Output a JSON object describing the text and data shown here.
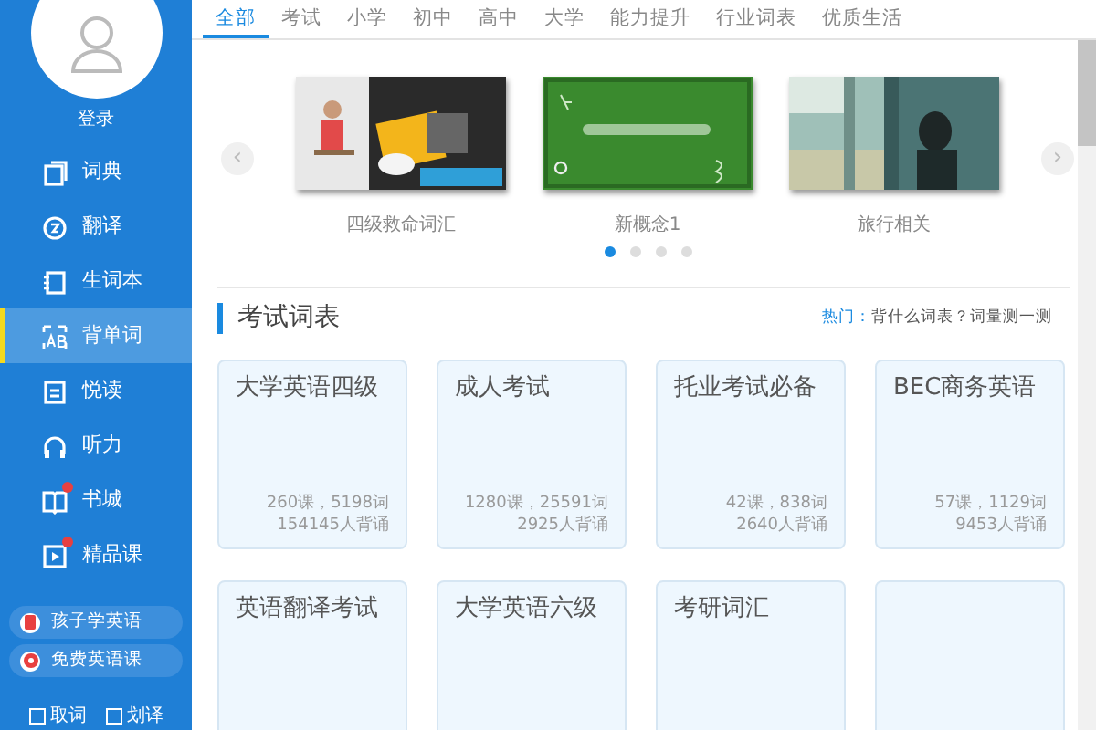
{
  "sidebar": {
    "login": "登录",
    "items": [
      {
        "label": "词典",
        "selected": false,
        "dot": false
      },
      {
        "label": "翻译",
        "selected": false,
        "dot": false
      },
      {
        "label": "生词本",
        "selected": false,
        "dot": false
      },
      {
        "label": "背单词",
        "selected": true,
        "dot": false
      },
      {
        "label": "悦读",
        "selected": false,
        "dot": false
      },
      {
        "label": "听力",
        "selected": false,
        "dot": false
      },
      {
        "label": "书城",
        "selected": false,
        "dot": true
      },
      {
        "label": "精品课",
        "selected": false,
        "dot": true
      }
    ],
    "promos": [
      {
        "label": "孩子学英语"
      },
      {
        "label": "免费英语课"
      }
    ],
    "options": [
      {
        "label": "取词",
        "checked": false
      },
      {
        "label": "划译",
        "checked": false
      }
    ]
  },
  "tabs": [
    {
      "label": "全部",
      "selected": true
    },
    {
      "label": "考试",
      "selected": false
    },
    {
      "label": "小学",
      "selected": false
    },
    {
      "label": "初中",
      "selected": false
    },
    {
      "label": "高中",
      "selected": false
    },
    {
      "label": "大学",
      "selected": false
    },
    {
      "label": "能力提升",
      "selected": false
    },
    {
      "label": "行业词表",
      "selected": false
    },
    {
      "label": "优质生活",
      "selected": false
    }
  ],
  "carousel": {
    "prev": "‹",
    "next": "›",
    "slides": [
      {
        "caption": "四级救命词汇",
        "kind": "picture"
      },
      {
        "caption": "新概念1",
        "kind": "picture"
      },
      {
        "caption": "旅行相关",
        "kind": "picture"
      }
    ],
    "dots": [
      {
        "selected": true
      },
      {
        "selected": false
      },
      {
        "selected": false
      },
      {
        "selected": false
      }
    ]
  },
  "section": {
    "title": "考试词表",
    "hot_label": "热门：",
    "hot_links": [
      "背什么词表？词量测一测"
    ]
  },
  "cards": [
    {
      "kind": "wordlist",
      "title": "大学英语四级",
      "stats": "260课，5198词",
      "learners": "154145人背诵"
    },
    {
      "kind": "wordlist",
      "title": "成人考试",
      "stats": "1280课，25591词",
      "learners": "2925人背诵"
    },
    {
      "kind": "wordlist",
      "title": "托业考试必备",
      "stats": "42课，838词",
      "learners": "2640人背诵"
    },
    {
      "kind": "wordlist",
      "title": "BEC商务英语",
      "stats": "57课，1129词",
      "learners": "9453人背诵"
    },
    {
      "kind": "wordlist",
      "title": "英语翻译考试"
    },
    {
      "kind": "wordlist",
      "title": "大学英语六级"
    },
    {
      "kind": "wordlist",
      "title": "考研词汇"
    },
    {
      "kind": "blank"
    }
  ]
}
